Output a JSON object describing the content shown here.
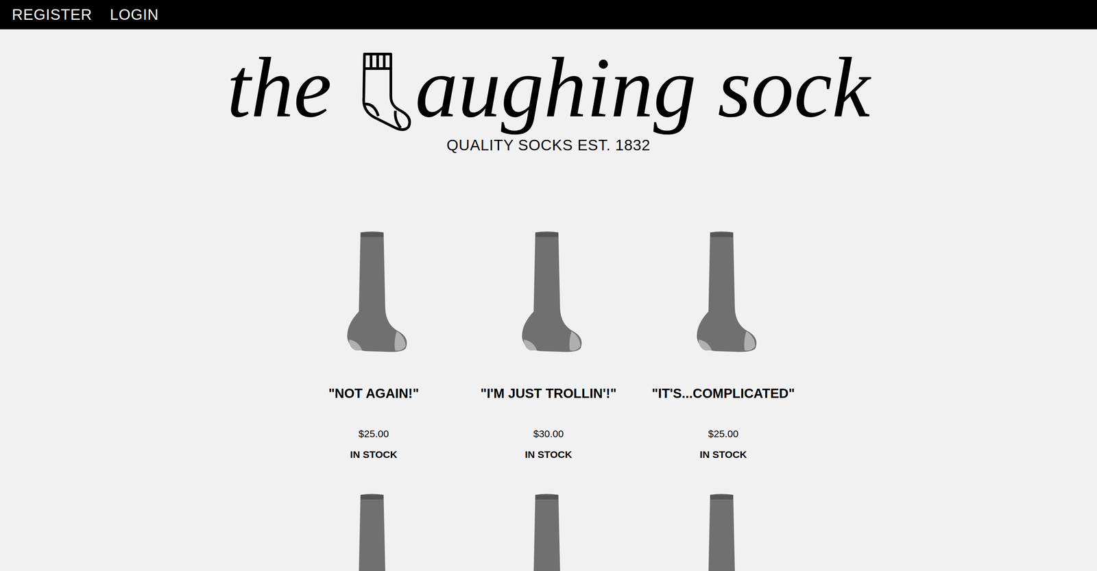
{
  "nav": {
    "links": [
      "REGISTER",
      "LOGIN"
    ]
  },
  "logo": {
    "before": "the ",
    "after": "aughing sock"
  },
  "tagline": "QUALITY SOCKS EST. 1832",
  "products": [
    {
      "kind": "full",
      "title": "\"NOT AGAIN!\"",
      "price": "$25.00",
      "stock": "IN STOCK"
    },
    {
      "kind": "full",
      "title": "\"I'M JUST TROLLIN'!\"",
      "price": "$30.00",
      "stock": "IN STOCK"
    },
    {
      "kind": "full",
      "title": "\"IT'S...COMPLICATED\"",
      "price": "$25.00",
      "stock": "IN STOCK"
    },
    {
      "kind": "cut"
    },
    {
      "kind": "cut"
    },
    {
      "kind": "cut"
    }
  ]
}
